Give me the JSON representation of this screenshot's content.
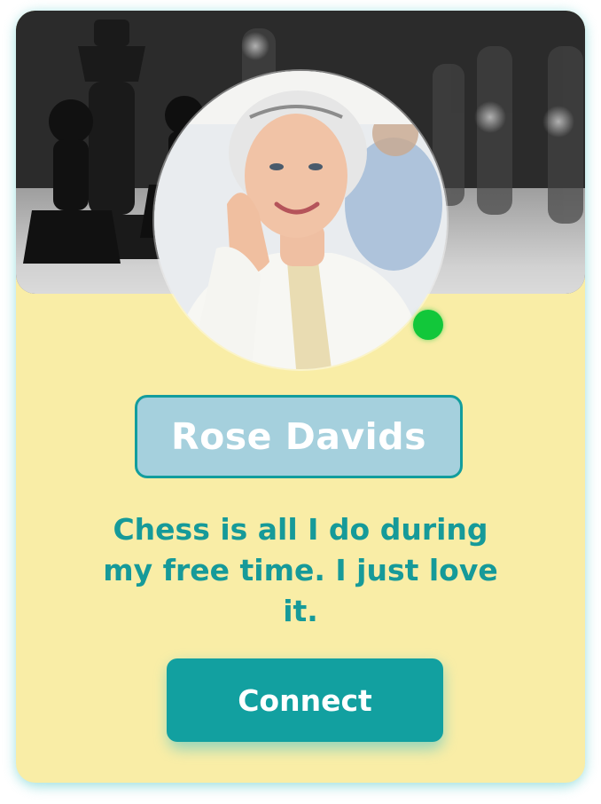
{
  "profile": {
    "name": "Rose Davids",
    "bio": "Chess is all I do during my free time. I just love it.",
    "status": "online",
    "status_color": "#12c73a"
  },
  "actions": {
    "connect_label": "Connect"
  },
  "images": {
    "banner": "chess-pieces-photo",
    "avatar": "profile-photo"
  },
  "colors": {
    "card_background": "#f9eda6",
    "accent": "#12a0a0",
    "name_box": "#a5d0dd",
    "bio_text": "#169a99"
  }
}
